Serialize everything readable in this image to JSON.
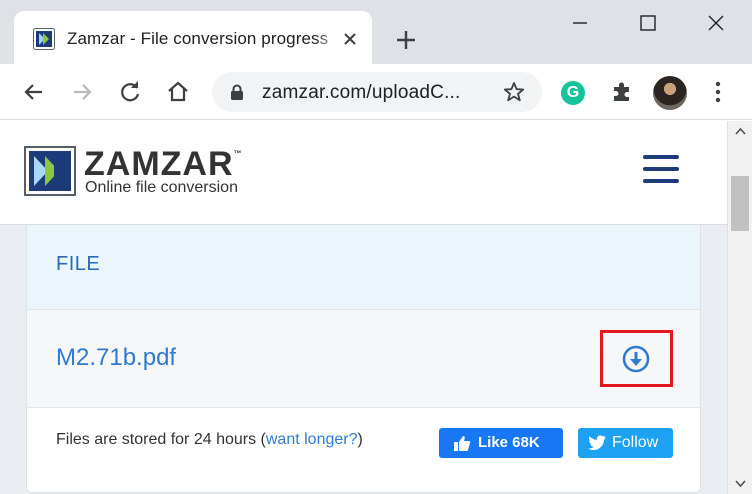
{
  "browser": {
    "tab": {
      "title": "Zamzar - File conversion progress"
    },
    "address": {
      "url": "zamzar.com/uploadC..."
    },
    "extension_letter": "G"
  },
  "site": {
    "logo_name": "ZAMZAR",
    "logo_tm": "™",
    "tagline": "Online file conversion"
  },
  "file_card": {
    "header_label": "FILE",
    "file_name": "M2.71b.pdf",
    "store_text": "Files are stored for 24 hours (",
    "want_longer": "want longer?",
    "store_close": ")",
    "like_label": "Like 68K",
    "follow_label": "Follow"
  },
  "colors": {
    "brand_blue": "#2f7bd3",
    "highlight_red": "#e3191f",
    "facebook": "#1877f2",
    "twitter": "#1da1f2"
  }
}
